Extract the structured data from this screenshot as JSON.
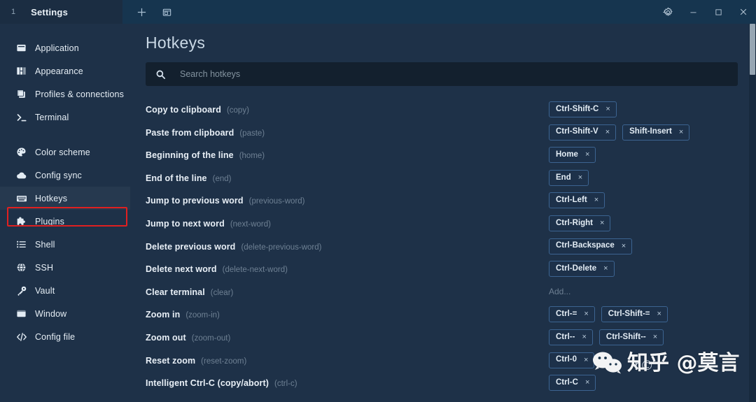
{
  "window": {
    "tab": {
      "index": "1",
      "title": "Settings"
    },
    "tabbar_actions": [
      {
        "name": "new-tab-icon",
        "label": "+"
      },
      {
        "name": "new-window-icon",
        "label": "❐"
      }
    ],
    "controls": [
      {
        "name": "settings-gear-icon",
        "label": "⚙"
      },
      {
        "name": "minimize-button",
        "label": "–"
      },
      {
        "name": "maximize-button",
        "label": "□"
      },
      {
        "name": "close-button",
        "label": "✕"
      }
    ]
  },
  "sidebar": {
    "groups": [
      {
        "items": [
          {
            "label": "Application",
            "icon": "application-icon",
            "active": false
          },
          {
            "label": "Appearance",
            "icon": "appearance-icon",
            "active": false
          },
          {
            "label": "Profiles & connections",
            "icon": "profiles-icon",
            "active": false
          },
          {
            "label": "Terminal",
            "icon": "terminal-icon",
            "active": false
          }
        ]
      },
      {
        "items": [
          {
            "label": "Color scheme",
            "icon": "palette-icon",
            "active": false
          },
          {
            "label": "Config sync",
            "icon": "cloud-icon",
            "active": false
          },
          {
            "label": "Hotkeys",
            "icon": "keyboard-icon",
            "active": true
          },
          {
            "label": "Plugins",
            "icon": "puzzle-icon",
            "active": false
          },
          {
            "label": "Shell",
            "icon": "list-icon",
            "active": false
          },
          {
            "label": "SSH",
            "icon": "globe-icon",
            "active": false
          },
          {
            "label": "Vault",
            "icon": "key-icon",
            "active": false
          },
          {
            "label": "Window",
            "icon": "window-icon",
            "active": false
          },
          {
            "label": "Config file",
            "icon": "code-icon",
            "active": false
          }
        ]
      }
    ],
    "highlight_label": "Hotkeys",
    "highlight_color": "#e02020"
  },
  "main": {
    "title": "Hotkeys",
    "search": {
      "placeholder": "Search hotkeys",
      "value": "",
      "icon": "search-icon"
    },
    "add_placeholder": "Add...",
    "rows": [
      {
        "name": "Copy to clipboard",
        "id": "(copy)",
        "chips": [
          "Ctrl-Shift-C"
        ]
      },
      {
        "name": "Paste from clipboard",
        "id": "(paste)",
        "chips": [
          "Ctrl-Shift-V",
          "Shift-Insert"
        ]
      },
      {
        "name": "Beginning of the line",
        "id": "(home)",
        "chips": [
          "Home"
        ]
      },
      {
        "name": "End of the line",
        "id": "(end)",
        "chips": [
          "End"
        ]
      },
      {
        "name": "Jump to previous word",
        "id": "(previous-word)",
        "chips": [
          "Ctrl-Left"
        ]
      },
      {
        "name": "Jump to next word",
        "id": "(next-word)",
        "chips": [
          "Ctrl-Right"
        ]
      },
      {
        "name": "Delete previous word",
        "id": "(delete-previous-word)",
        "chips": [
          "Ctrl-Backspace"
        ]
      },
      {
        "name": "Delete next word",
        "id": "(delete-next-word)",
        "chips": [
          "Ctrl-Delete"
        ]
      },
      {
        "name": "Clear terminal",
        "id": "(clear)",
        "chips": []
      },
      {
        "name": "Zoom in",
        "id": "(zoom-in)",
        "chips": [
          "Ctrl-=",
          "Ctrl-Shift-="
        ]
      },
      {
        "name": "Zoom out",
        "id": "(zoom-out)",
        "chips": [
          "Ctrl--",
          "Ctrl-Shift--"
        ]
      },
      {
        "name": "Reset zoom",
        "id": "(reset-zoom)",
        "chips": [
          "Ctrl-0"
        ]
      },
      {
        "name": "Intelligent Ctrl-C (copy/abort)",
        "id": "(ctrl-c)",
        "chips": [
          "Ctrl-C"
        ]
      }
    ],
    "chip_remove_glyph": "×"
  },
  "watermark": {
    "text": "知乎 @莫言",
    "overlay": "r©"
  },
  "theme": {
    "bg": "#1e3148",
    "titlebar": "#16354f",
    "tab_bg": "#1b2d42",
    "search_bg": "#13202e",
    "chip_border": "#3c6491",
    "accent_red": "#e02020"
  }
}
